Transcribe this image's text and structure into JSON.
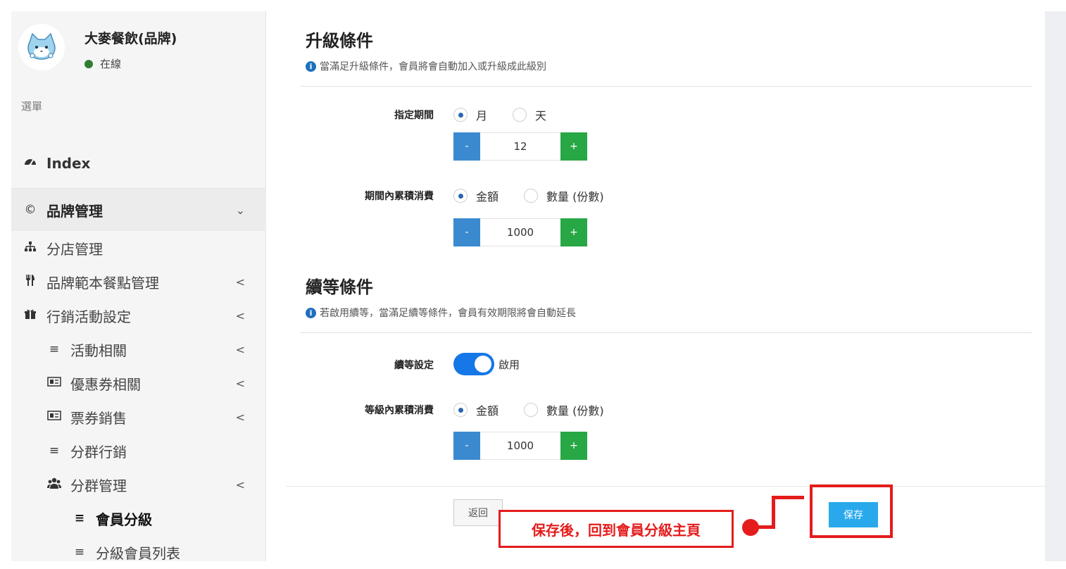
{
  "sidebar": {
    "brand_name": "大麥餐飲(品牌)",
    "status": "在線",
    "menu_header": "選單",
    "items": [
      {
        "label": "Index",
        "icon": "dashboard-icon"
      },
      {
        "label": "品牌管理",
        "icon": "copyright-icon",
        "arrow": "⌄"
      },
      {
        "label": "分店管理",
        "icon": "sitemap-icon"
      },
      {
        "label": "品牌範本餐點管理",
        "icon": "utensils-icon",
        "arrow": "<"
      },
      {
        "label": "行銷活動設定",
        "icon": "gift-icon",
        "arrow": "<"
      },
      {
        "label": "活動相關",
        "icon": "list-icon",
        "arrow": "<"
      },
      {
        "label": "優惠券相關",
        "icon": "ticket-icon",
        "arrow": "<"
      },
      {
        "label": "票券銷售",
        "icon": "ticket-icon",
        "arrow": "<"
      },
      {
        "label": "分群行銷",
        "icon": "list-icon"
      },
      {
        "label": "分群管理",
        "icon": "users-icon",
        "arrow": "<"
      },
      {
        "label": "會員分級",
        "icon": "list-icon"
      },
      {
        "label": "分級會員列表",
        "icon": "list-icon"
      }
    ]
  },
  "upgrade": {
    "title": "升級條件",
    "info": "當滿足升級條件，會員將會自動加入或升級成此級別",
    "period_label": "指定期間",
    "period_options": [
      "月",
      "天"
    ],
    "period_value": "12",
    "spend_label": "期間內累積消費",
    "spend_options": [
      "金額",
      "數量 (份數)"
    ],
    "spend_value": "1000"
  },
  "renewal": {
    "title": "續等條件",
    "info": "若啟用續等，當滿足續等條件，會員有效期限將會自動延長",
    "toggle_label": "續等設定",
    "toggle_text": "啟用",
    "spend_label": "等級內累積消費",
    "spend_options": [
      "金額",
      "數量 (份數)"
    ],
    "spend_value": "1000"
  },
  "footer": {
    "back_label": "返回",
    "save_label": "保存"
  },
  "callout": "保存後，回到會員分級主頁",
  "stepper": {
    "minus": "-",
    "plus": "+"
  }
}
